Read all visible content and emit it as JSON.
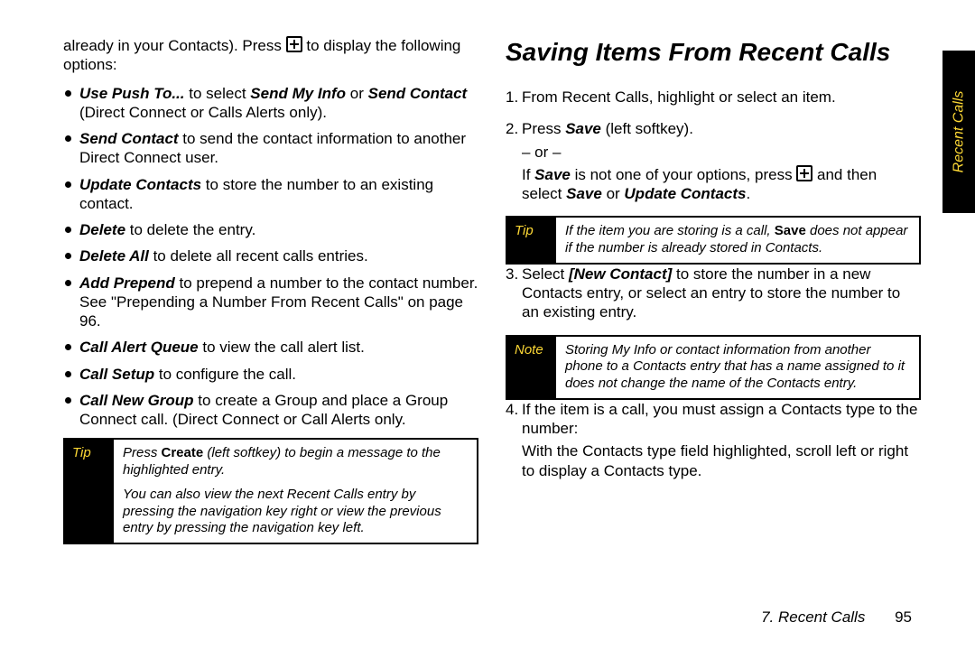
{
  "left": {
    "intro_prefix": "already in your Contacts). Press ",
    "intro_suffix": " to display the following options:",
    "bullets": {
      "b1": {
        "term": "Use Push To...",
        "rest": " to select ",
        "term2": "Send My Info",
        "mid": " or ",
        "term3": "Send Contact",
        "tail": " (Direct Connect or Calls Alerts only)."
      },
      "b2": {
        "term": "Send Contact",
        "rest": " to send the contact information to another Direct Connect user."
      },
      "b3": {
        "term": "Update Contacts",
        "rest": " to store the number to an existing contact."
      },
      "b4": {
        "term": "Delete",
        "rest": " to delete the entry."
      },
      "b5": {
        "term": "Delete All",
        "rest": " to delete all recent calls entries."
      },
      "b6": {
        "term": "Add Prepend",
        "rest": " to prepend a number to the contact number. See \"Prepending a Number From Recent Calls\" on page 96."
      },
      "b7": {
        "term": "Call Alert Queue",
        "rest": " to view the call alert list."
      },
      "b8": {
        "term": "Call Setup",
        "rest": " to configure the call."
      },
      "b9": {
        "term": "Call New Group",
        "rest": " to create a Group and place a Group Connect call. (Direct Connect or Call Alerts only."
      }
    },
    "tip_tag": "Tip",
    "tip": {
      "p1_prefix": "Press ",
      "p1_bold": "Create",
      "p1_suffix": " (left softkey) to begin a message to the highlighted entry.",
      "p2": "You can also view the next Recent Calls entry by pressing the navigation key right or view the previous entry by pressing the navigation key left."
    }
  },
  "right": {
    "title": "Saving Items From Recent Calls",
    "steps": {
      "s1": "From Recent Calls, highlight or select an item.",
      "s2_a_prefix": "Press ",
      "s2_a_bold": "Save",
      "s2_a_suffix": " (left softkey).",
      "s2_or": "– or –",
      "s2_b_prefix": "If ",
      "s2_b_bold1": "Save",
      "s2_b_mid": " is not one of your options, press ",
      "s2_b_mid2": " and then select ",
      "s2_b_bold2": "Save",
      "s2_b_or": " or ",
      "s2_b_bold3": "Update Contacts",
      "s2_b_end": ".",
      "tip_tag": "Tip",
      "tip_prefix": "If the item you are storing is a call, ",
      "tip_bold": "Save",
      "tip_suffix": " does not appear if the number is already stored in Contacts.",
      "s3_prefix": "Select ",
      "s3_bold": "[New Contact]",
      "s3_suffix": " to store the number in a new Contacts entry, or select an entry to store the number to an existing entry.",
      "note_tag": "Note",
      "note": "Storing My Info or contact information from another phone to a Contacts entry that has a name assigned to it does not change the name of the Contacts entry.",
      "s4_a": "If the item is a call, you must assign a Contacts type to the number:",
      "s4_b": "With the Contacts type field highlighted, scroll left or right to display a Contacts type."
    }
  },
  "tab": "Recent Calls",
  "footer": {
    "chapter": "7. Recent Calls",
    "page": "95"
  }
}
